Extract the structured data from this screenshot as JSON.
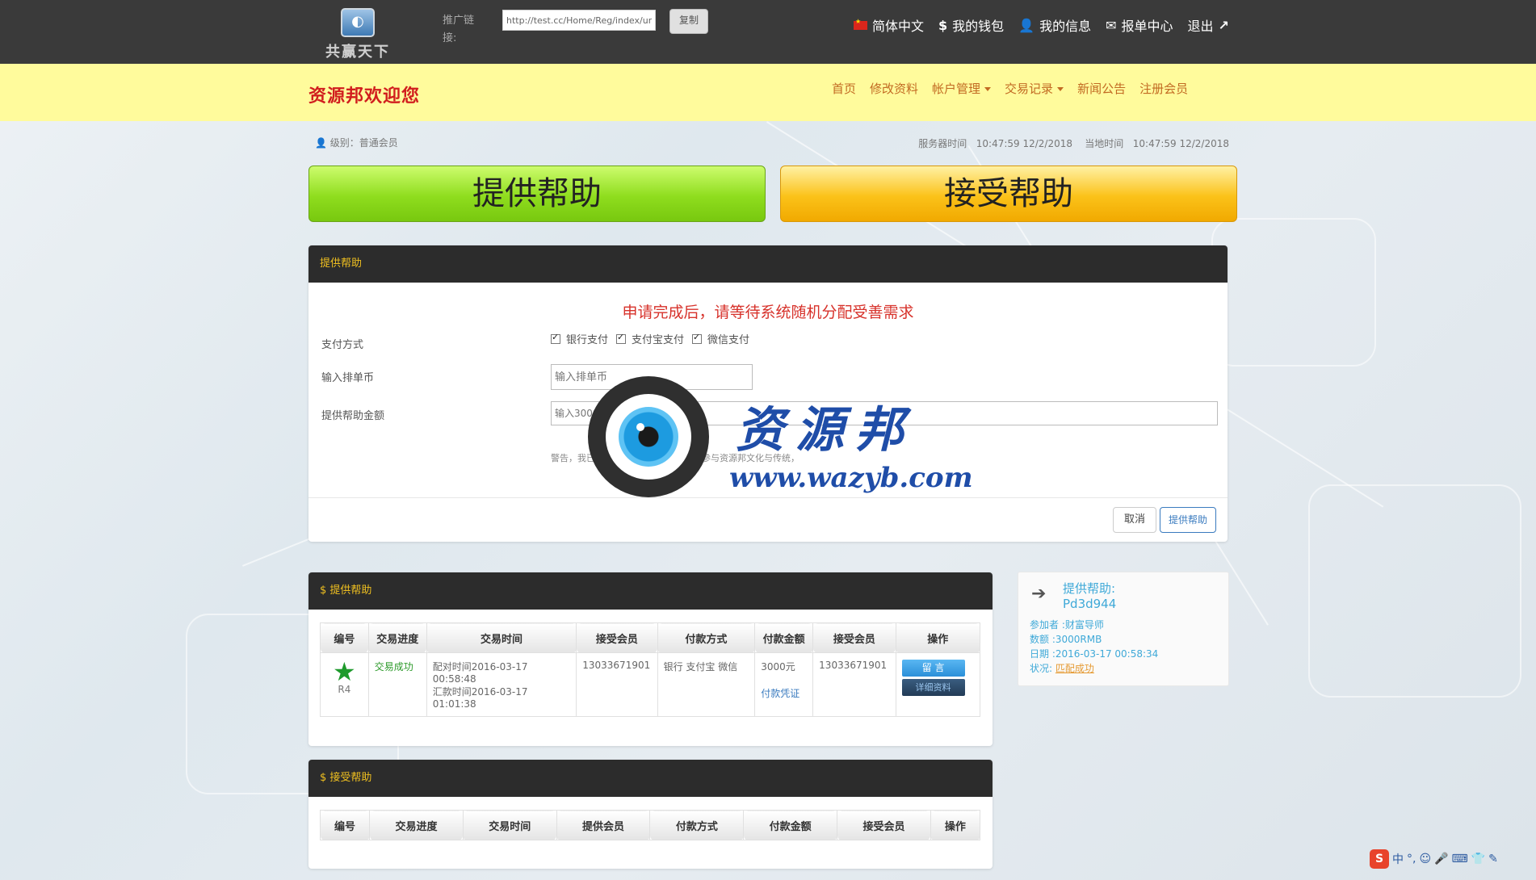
{
  "topbar": {
    "logo_text": "共赢天下",
    "promo_label": "推广链接:",
    "promo_value": "http://test.cc/Home/Reg/index/unam",
    "copy_label": "复制",
    "nav": [
      "简体中文",
      "我的钱包",
      "我的信息",
      "报单中心",
      "退出"
    ]
  },
  "header": {
    "welcome": "资源邦欢迎您",
    "nav": [
      "首页",
      "修改资料",
      "帐户管理",
      "交易记录",
      "新闻公告",
      "注册会员"
    ]
  },
  "info": {
    "level": "级别：普通会员",
    "server_time_label": "服务器时间",
    "server_time": "10:47:59 12/2/2018",
    "local_time_label": "当地时间",
    "local_time": "10:47:59 12/2/2018"
  },
  "actions": {
    "provide": "提供帮助",
    "accept": "接受帮助"
  },
  "form": {
    "title": "提供帮助",
    "notice": "申请完成后，请等待系统随机分配受善需求",
    "payment_label": "支付方式",
    "payment_options": [
      "银行支付",
      "支付宝支付",
      "微信支付"
    ],
    "coin_label": "输入排单币",
    "coin_placeholder": "输入排单币",
    "amount_label": "提供帮助金额",
    "amount_placeholder": "输入3000-50",
    "warning": "警告，我已完全了解所有风险，我决定参与资源邦文化与传统，",
    "cancel": "取消",
    "submit": "提供帮助"
  },
  "watermark": {
    "name": "资源邦",
    "url": "www.wazyb.com"
  },
  "provide_table": {
    "title": "$ 提供帮助",
    "headers": [
      "编号",
      "交易进度",
      "交易时间",
      "接受会员",
      "付款方式",
      "付款金额",
      "接受会员",
      "操作"
    ],
    "row": {
      "id": "R4",
      "progress": "交易成功",
      "match_time": "配对时间2016-03-17 00:58:48",
      "pay_time": "汇款时间2016-03-17 01:01:38",
      "receiver": "13033671901",
      "method": "银行 支付宝 微信",
      "amount": "3000元",
      "proof": "付款凭证",
      "receiver2": "13033671901",
      "msg_btn": "留 言",
      "detail_btn": "详细资料"
    }
  },
  "accept_table": {
    "title": "$ 接受帮助",
    "headers": [
      "编号",
      "交易进度",
      "交易时间",
      "提供会员",
      "付款方式",
      "付款金额",
      "接受会员",
      "操作"
    ]
  },
  "side_card": {
    "title": "提供帮助:",
    "code": "Pd3d944",
    "participant": "参加者 :财富导师",
    "amount": "数额 :3000RMB",
    "date": "日期 :2016-03-17 00:58:34",
    "status_label": "状况:",
    "status": "匹配成功"
  },
  "tray": {
    "items": [
      "中",
      "°,",
      "☺",
      "🎤",
      "⌨",
      "👕",
      "✎"
    ]
  }
}
